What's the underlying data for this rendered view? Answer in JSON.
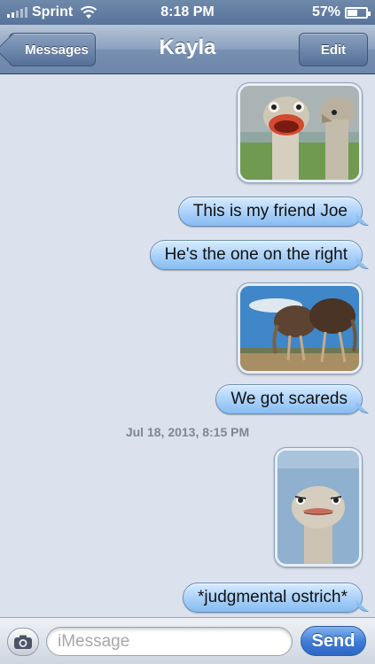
{
  "status_bar": {
    "carrier": "Sprint",
    "time": "8:18 PM",
    "battery": "57%",
    "battery_level": 0.57,
    "signal_bars": 2
  },
  "nav": {
    "back_label": "Messages",
    "title": "Kayla",
    "edit_label": "Edit"
  },
  "messages": [
    {
      "type": "image",
      "icon": "ostrich-closeup-photo"
    },
    {
      "type": "text",
      "text": "This is my friend Joe"
    },
    {
      "type": "text",
      "text": "He's the one on the right"
    },
    {
      "type": "image",
      "icon": "ostriches-heads-down-photo"
    },
    {
      "type": "text",
      "text": "We got scareds"
    },
    {
      "type": "timestamp",
      "text": "Jul 18, 2013, 8:15 PM"
    },
    {
      "type": "image",
      "icon": "ostrich-judgmental-photo"
    },
    {
      "type": "text",
      "text": "*judgmental ostrich*"
    }
  ],
  "input_bar": {
    "placeholder": "iMessage",
    "send_label": "Send",
    "camera_icon": "camera-icon"
  },
  "colors": {
    "outgoing_bubble": "#a9d0f8",
    "nav_bar": "#7890b1",
    "background": "#dbe2ed",
    "send_button": "#3d7ad6"
  }
}
